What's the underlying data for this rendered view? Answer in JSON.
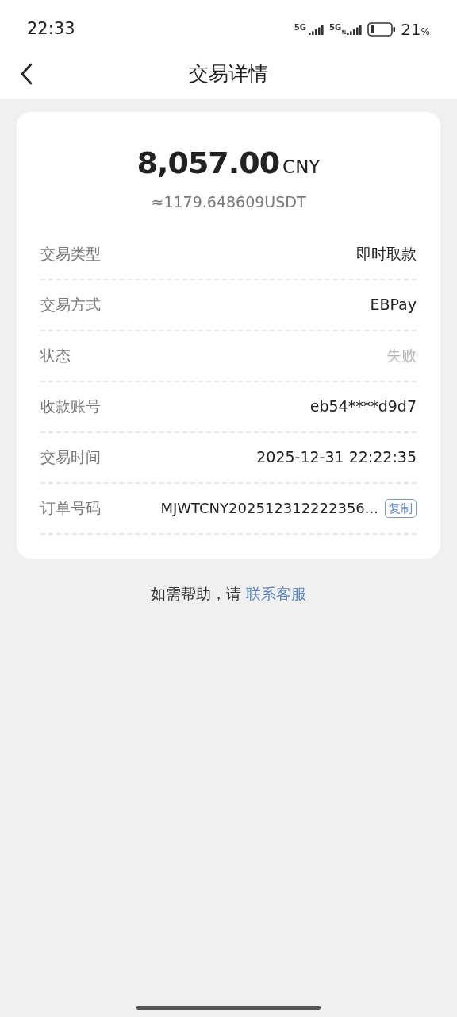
{
  "status_bar": {
    "time": "22:33",
    "network_1": "5G",
    "network_2": "5G",
    "battery": "21",
    "battery_unit": "%"
  },
  "header": {
    "title": "交易详情"
  },
  "amount": {
    "value": "8,057.00",
    "currency": "CNY",
    "converted": "≈1179.648609USDT"
  },
  "rows": [
    {
      "label": "交易类型",
      "value": "即时取款",
      "kind": "plain"
    },
    {
      "label": "交易方式",
      "value": "EBPay",
      "kind": "plain"
    },
    {
      "label": "状态",
      "value": "失败",
      "kind": "muted"
    },
    {
      "label": "收款账号",
      "value": "eb54****d9d7",
      "kind": "plain"
    },
    {
      "label": "交易时间",
      "value": "2025-12-31 22:22:35",
      "kind": "plain"
    },
    {
      "label": "订单号码",
      "value": "MJWTCNY202512312222356...",
      "kind": "copy",
      "action": "复制"
    }
  ],
  "help": {
    "text": "如需帮助，请",
    "link": "联系客服"
  }
}
